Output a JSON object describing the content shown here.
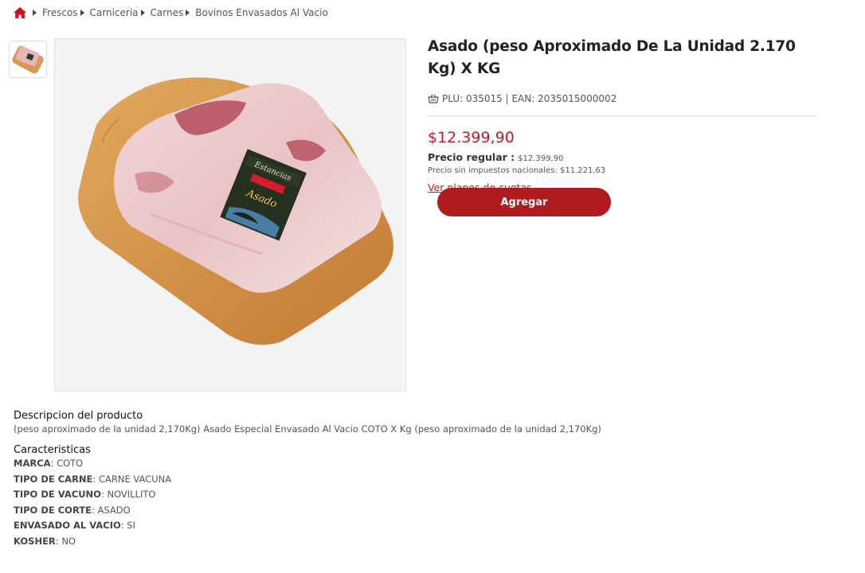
{
  "breadcrumb": {
    "items": [
      "Frescos",
      "Carniceria",
      "Carnes",
      "Bovinos Envasados Al Vacio"
    ]
  },
  "product": {
    "title": "Asado (peso Aproximado De La Unidad 2.170 Kg) X KG",
    "codes": "PLU: 035015 | EAN: 2035015000002",
    "price": "$12.399,90",
    "regular_label": "Precio regular :",
    "regular_value": "$12.399,90",
    "no_tax_text": "Precio sin impuestos nacionales: $11.221,63",
    "installments_link": "Ver planes de cuotas",
    "add_button": "Agregar",
    "package_label_brand": "Estancias",
    "package_label_name": "Asado"
  },
  "description": {
    "heading": "Descripcion del producto",
    "text": "(peso aproximado de la unidad 2,170Kg) Asado Especial Envasado Al Vacio COTO X Kg (peso aproximado de la unidad 2,170Kg)"
  },
  "features": {
    "heading": "Caracteristicas",
    "items": [
      {
        "key": "MARCA",
        "value": ": COTO"
      },
      {
        "key": "TIPO DE CARNE",
        "value": ": CARNE VACUNA"
      },
      {
        "key": "TIPO DE VACUNO",
        "value": ": NOVILLITO"
      },
      {
        "key": "TIPO DE CORTE",
        "value": ": ASADO"
      },
      {
        "key": "ENVASADO AL VACIO",
        "value": ": SI"
      },
      {
        "key": "KOSHER",
        "value": ": NO"
      }
    ]
  },
  "icons": {
    "home": "home-icon",
    "separator": "caret-right-icon",
    "basket": "basket-icon"
  },
  "colors": {
    "accent": "#c5172b",
    "button": "#b01b1f"
  }
}
